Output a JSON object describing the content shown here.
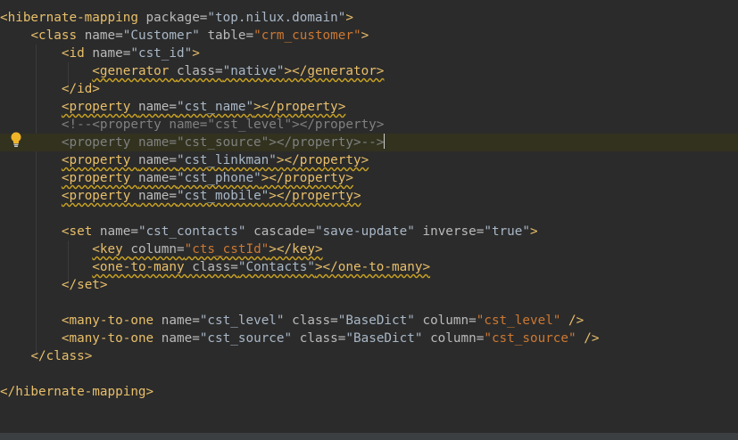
{
  "editor": {
    "lines": [
      [
        [
          "t",
          "<hibernate-mapping "
        ],
        [
          "a",
          "package="
        ],
        [
          "txt",
          "\"top.nilux.domain\""
        ],
        [
          "t",
          ">"
        ]
      ],
      [
        [
          "txt",
          "    "
        ],
        [
          "t",
          "<class "
        ],
        [
          "a",
          "name="
        ],
        [
          "txt",
          "\"Customer\" "
        ],
        [
          "a",
          "table="
        ],
        [
          "s",
          "\"crm_customer\""
        ],
        [
          "t",
          ">"
        ]
      ],
      [
        [
          "txt",
          "        "
        ],
        [
          "t",
          "<id "
        ],
        [
          "a",
          "name="
        ],
        [
          "txt",
          "\"cst_id\""
        ],
        [
          "t",
          ">"
        ]
      ],
      [
        [
          "txt",
          "            "
        ],
        [
          "t",
          "<generator ",
          "w"
        ],
        [
          "a",
          "class=",
          "w"
        ],
        [
          "txt",
          "\"native\"",
          "w"
        ],
        [
          "t",
          "></generator>",
          "w"
        ]
      ],
      [
        [
          "txt",
          "        "
        ],
        [
          "t",
          "</id>"
        ]
      ],
      [
        [
          "txt",
          "        "
        ],
        [
          "t",
          "<property ",
          "w"
        ],
        [
          "a",
          "name=",
          "w"
        ],
        [
          "txt",
          "\"cst_name\"",
          "w"
        ],
        [
          "t",
          "></property>",
          "w"
        ]
      ],
      [
        [
          "txt",
          "        "
        ],
        [
          "c",
          "<!--<property name=\"cst_level\"></property>"
        ]
      ],
      [
        [
          "txt",
          "        "
        ],
        [
          "c",
          "<property name=\"cst_source\"></property>-->"
        ],
        [
          "caret",
          ""
        ]
      ],
      [
        [
          "txt",
          "        "
        ],
        [
          "t",
          "<property ",
          "w"
        ],
        [
          "a",
          "name=",
          "w"
        ],
        [
          "txt",
          "\"cst_linkman\"",
          "w"
        ],
        [
          "t",
          "></property>",
          "w"
        ]
      ],
      [
        [
          "txt",
          "        "
        ],
        [
          "t",
          "<property ",
          "w"
        ],
        [
          "a",
          "name=",
          "w"
        ],
        [
          "txt",
          "\"cst_phone\"",
          "w"
        ],
        [
          "t",
          "></property>",
          "w"
        ]
      ],
      [
        [
          "txt",
          "        "
        ],
        [
          "t",
          "<property ",
          "w"
        ],
        [
          "a",
          "name=",
          "w"
        ],
        [
          "txt",
          "\"cst_mobile\"",
          "w"
        ],
        [
          "t",
          "></property>",
          "w"
        ]
      ],
      [],
      [
        [
          "txt",
          "        "
        ],
        [
          "t",
          "<set "
        ],
        [
          "a",
          "name="
        ],
        [
          "txt",
          "\"cst_contacts\" "
        ],
        [
          "a",
          "cascade="
        ],
        [
          "txt",
          "\"save-update\" "
        ],
        [
          "a",
          "inverse="
        ],
        [
          "txt",
          "\"true\""
        ],
        [
          "t",
          ">"
        ]
      ],
      [
        [
          "txt",
          "            "
        ],
        [
          "t",
          "<key ",
          "w"
        ],
        [
          "a",
          "column=",
          "w"
        ],
        [
          "s",
          "\"cts_cstId\"",
          "w"
        ],
        [
          "t",
          "></key>",
          "w"
        ]
      ],
      [
        [
          "txt",
          "            "
        ],
        [
          "t",
          "<one-to-many ",
          "w"
        ],
        [
          "a",
          "class=",
          "w"
        ],
        [
          "txt",
          "\"Contacts\"",
          "w"
        ],
        [
          "t",
          "></one-to-many>",
          "w"
        ]
      ],
      [
        [
          "txt",
          "        "
        ],
        [
          "t",
          "</set>"
        ]
      ],
      [],
      [
        [
          "txt",
          "        "
        ],
        [
          "t",
          "<many-to-one "
        ],
        [
          "a",
          "name="
        ],
        [
          "txt",
          "\"cst_level\" "
        ],
        [
          "a",
          "class="
        ],
        [
          "txt",
          "\"BaseDict\" "
        ],
        [
          "a",
          "column="
        ],
        [
          "s",
          "\"cst_level\""
        ],
        [
          "t",
          " />"
        ]
      ],
      [
        [
          "txt",
          "        "
        ],
        [
          "t",
          "<many-to-one "
        ],
        [
          "a",
          "name="
        ],
        [
          "txt",
          "\"cst_source\" "
        ],
        [
          "a",
          "class="
        ],
        [
          "txt",
          "\"BaseDict\" "
        ],
        [
          "a",
          "column="
        ],
        [
          "s",
          "\"cst_source\""
        ],
        [
          "t",
          " />"
        ]
      ],
      [
        [
          "txt",
          "    "
        ],
        [
          "t",
          "</class>"
        ]
      ],
      [],
      [
        [
          "t",
          "</hibernate-mapping>"
        ]
      ]
    ],
    "current_line": 7,
    "gutter_icon": "lightbulb-icon",
    "colors": {
      "background": "#2b2b2b",
      "current_line": "#32321f",
      "tag": "#e8bf6a",
      "attribute": "#bababa",
      "string_value": "#a9b7c6",
      "sql_reference": "#cc7832",
      "comment": "#808080",
      "warning_underline": "#c9a223"
    }
  }
}
